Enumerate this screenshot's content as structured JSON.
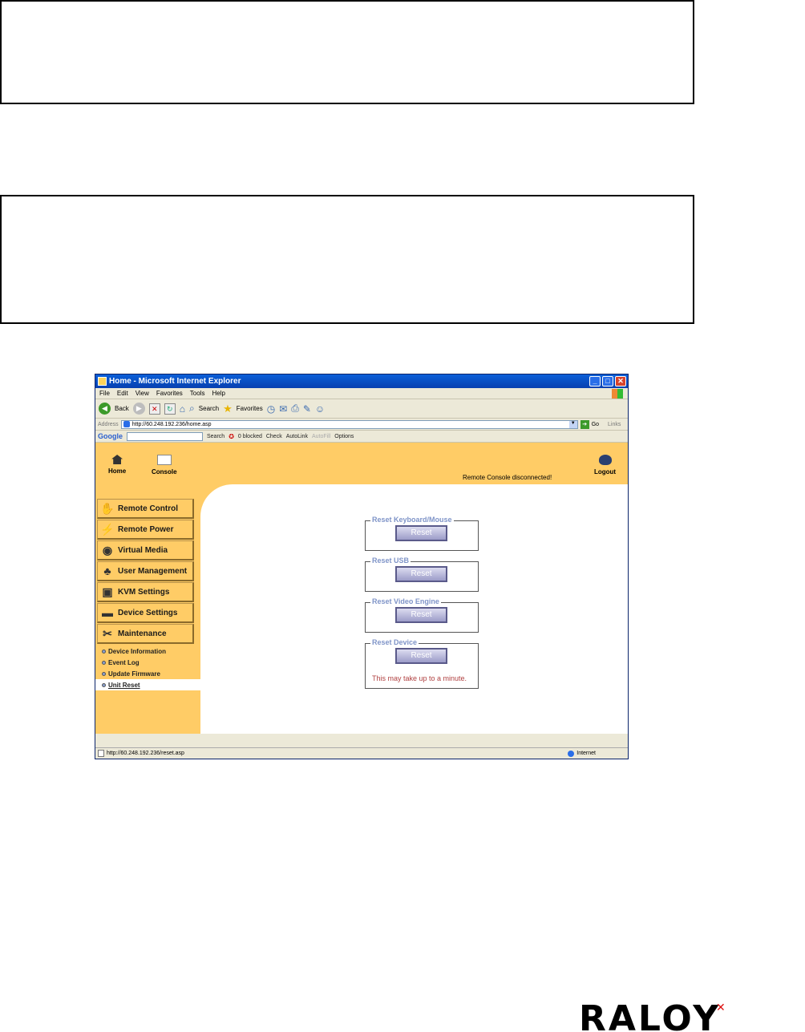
{
  "browser": {
    "title": "Home - Microsoft Internet Explorer",
    "menu": [
      "File",
      "Edit",
      "View",
      "Favorites",
      "Tools",
      "Help"
    ],
    "toolbar": {
      "back": "Back",
      "search": "Search",
      "favorites": "Favorites"
    },
    "address_label": "Address",
    "address": "http://60.248.192.236/home.asp",
    "go": "Go",
    "links": "Links",
    "google_bar": {
      "logo": "Google",
      "search": "Search",
      "blocked": "0 blocked",
      "check": "Check",
      "autolink": "AutoLink",
      "autofill": "AutoFill",
      "options": "Options"
    },
    "status_url": "http://60.248.192.236/reset.asp",
    "status_zone": "Internet"
  },
  "topnav": {
    "home": "Home",
    "console": "Console",
    "logout": "Logout",
    "status": "Remote Console disconnected!"
  },
  "sidebar": {
    "items": [
      {
        "label": "Remote Control",
        "icon": "remote-control-icon"
      },
      {
        "label": "Remote Power",
        "icon": "power-icon"
      },
      {
        "label": "Virtual Media",
        "icon": "virtual-media-icon"
      },
      {
        "label": "User Management",
        "icon": "users-icon"
      },
      {
        "label": "KVM Settings",
        "icon": "kvm-icon"
      },
      {
        "label": "Device Settings",
        "icon": "device-settings-icon"
      },
      {
        "label": "Maintenance",
        "icon": "tools-icon"
      }
    ],
    "subitems": [
      "Device Information",
      "Event Log",
      "Update Firmware",
      "Unit Reset"
    ]
  },
  "reset": {
    "groups": [
      {
        "label": "Reset Keyboard/Mouse",
        "button": "Reset"
      },
      {
        "label": "Reset USB",
        "button": "Reset"
      },
      {
        "label": "Reset Video Engine",
        "button": "Reset"
      },
      {
        "label": "Reset Device",
        "button": "Reset",
        "note": "This may take up to a minute."
      }
    ]
  },
  "brand": "RALOY"
}
